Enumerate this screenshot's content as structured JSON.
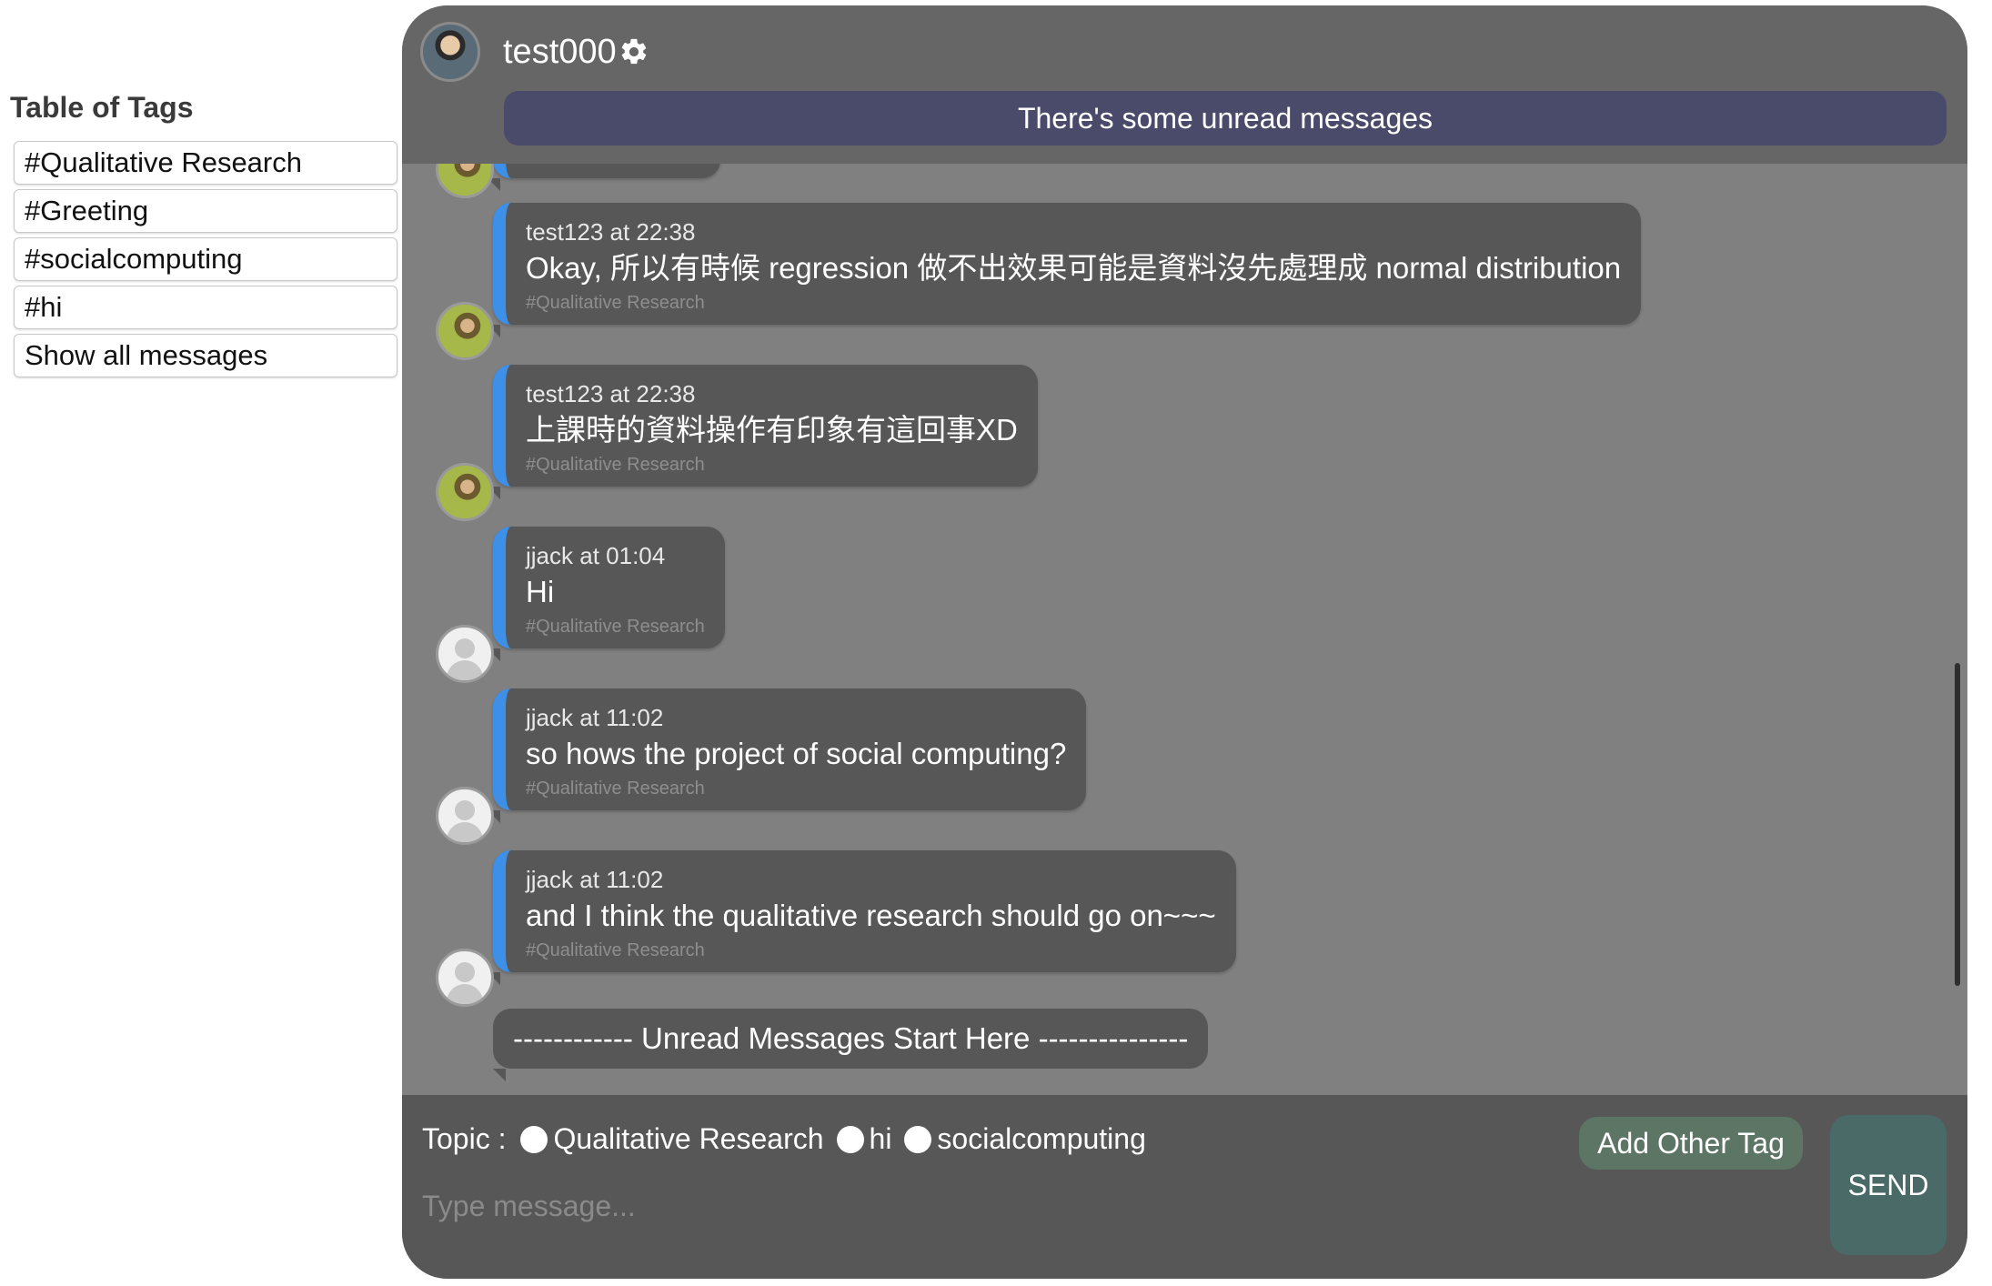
{
  "tags_panel": {
    "heading": "Table of Tags",
    "items": [
      "#Qualitative Research",
      "#Greeting",
      "#socialcomputing",
      "#hi",
      "Show all messages"
    ]
  },
  "header": {
    "username": "test000",
    "unread_banner": "There's some unread messages"
  },
  "messages": [
    {
      "meta": "test123 at 22:38",
      "text": "Okay, 所以有時候 regression 做不出效果可能是資料沒先處理成 normal distribution",
      "tag": "#Qualitative Research",
      "avatar": "photo"
    },
    {
      "meta": "test123 at 22:38",
      "text": "上課時的資料操作有印象有這回事XD",
      "tag": "#Qualitative Research",
      "avatar": "photo"
    },
    {
      "meta": "jjack at 01:04",
      "text": "Hi",
      "tag": "#Qualitative Research",
      "avatar": "blank"
    },
    {
      "meta": "jjack at 11:02",
      "text": "so hows the project of social computing?",
      "tag": "#Qualitative Research",
      "avatar": "blank"
    },
    {
      "meta": "jjack at 11:02",
      "text": "and I think the qualitative research should go on~~~",
      "tag": "#Qualitative Research",
      "avatar": "blank"
    }
  ],
  "unread_divider": "------------ Unread Messages Start Here ---------------",
  "composer": {
    "topic_label": "Topic :",
    "topics": [
      "Qualitative Research",
      "hi",
      "socialcomputing"
    ],
    "placeholder": "Type message...",
    "add_tag_label": "Add Other Tag",
    "send_label": "SEND"
  },
  "colors": {
    "bubble_accent": "#3d8fe8",
    "banner": "#4a4a6a",
    "chat_bg": "#808080"
  },
  "icons": [
    "gear-icon",
    "user-avatar-icon"
  ]
}
